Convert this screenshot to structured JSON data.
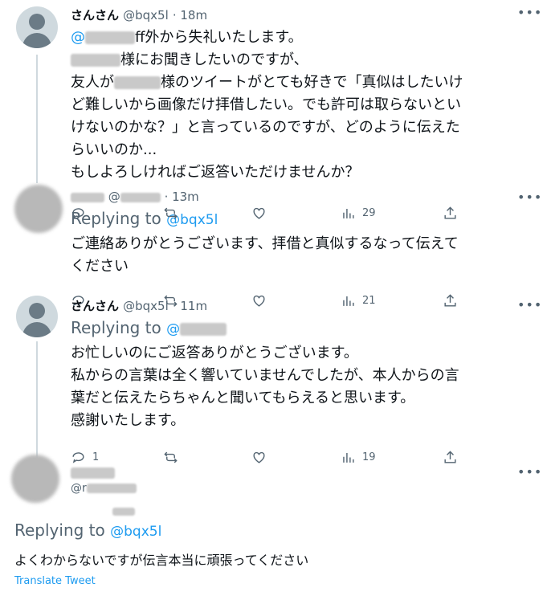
{
  "colors": {
    "accent": "#1d9bf0",
    "muted": "#536471",
    "text": "#0f1419"
  },
  "tweets": [
    {
      "name": "さんさん",
      "handle": "@bqx5l",
      "time": "· 18m",
      "lines": [
        "ff外から失礼いたします。",
        "様にお聞きしたいのですが、",
        "友人が",
        "様のツイートがとても好きで「真似はしたいけ",
        "ど難しいから画像だけ拝借したい。でも許可は取らないとい",
        "けないのかな？」と言っているのですが、どのように伝えた",
        "らいいのか...",
        "もしよろしければご返答いただけませんか？"
      ],
      "mention_prefix": "@"
    },
    {
      "handle_prefix": "@",
      "time": "· 13m",
      "replying_label": "Replying to",
      "replying_handle": "@bqx5l",
      "lines": [
        "ご連絡ありがとうございます、拝借と真似するなって伝えて",
        "ください"
      ],
      "views": "29"
    },
    {
      "name": "さんさん",
      "handle": "@bqx5l",
      "time": "· 11m",
      "replying_label": "Replying to",
      "replying_handle": "@",
      "lines": [
        "お忙しいのにご返答ありがとうございます。",
        "私からの言葉は全く響いていませんでしたが、本人からの言",
        "葉だと伝えたらちゃんと聞いてもらえると思います。",
        "感謝いたします。"
      ],
      "views": "21"
    },
    {
      "handle_prefix": "@r",
      "replying_label": "Replying to",
      "replying_handle": "@bqx5l",
      "lines": [
        "よくわからないですが伝言本当に頑張ってください"
      ],
      "reply_count": "1",
      "views": "19",
      "translate": "Translate Tweet"
    }
  ],
  "icons": [
    "reply-icon",
    "retweet-icon",
    "like-icon",
    "views-icon",
    "share-icon",
    "more-icon"
  ]
}
